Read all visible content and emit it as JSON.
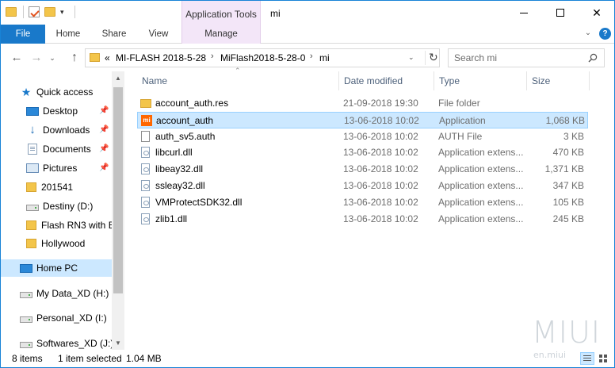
{
  "window": {
    "title": "mi",
    "contextual_group": "Application Tools",
    "controls": [
      "minimize",
      "maximize",
      "close"
    ]
  },
  "ribbon": {
    "tabs": [
      {
        "label": "File"
      },
      {
        "label": "Home"
      },
      {
        "label": "Share"
      },
      {
        "label": "View"
      },
      {
        "label": "Manage"
      }
    ],
    "help": "?"
  },
  "address": {
    "overflow": "«",
    "crumbs": [
      "MI-FLASH 2018-5-28",
      "MiFlash2018-5-28-0",
      "mi"
    ]
  },
  "search": {
    "placeholder": "Search mi"
  },
  "nav_pane": {
    "items": [
      {
        "label": "Quick access",
        "icon": "star-icon",
        "pinned": false
      },
      {
        "label": "Desktop",
        "icon": "desktop-icon",
        "pinned": true
      },
      {
        "label": "Downloads",
        "icon": "download-icon",
        "pinned": true
      },
      {
        "label": "Documents",
        "icon": "documents-icon",
        "pinned": true
      },
      {
        "label": "Pictures",
        "icon": "pictures-icon",
        "pinned": true
      },
      {
        "label": "201541",
        "icon": "folder-icon",
        "pinned": false
      },
      {
        "label": "Destiny (D:)",
        "icon": "drive-icon",
        "pinned": false
      },
      {
        "label": "Flash RN3 with E",
        "icon": "folder-icon",
        "pinned": false
      },
      {
        "label": "Hollywood",
        "icon": "folder-icon",
        "pinned": false
      },
      {
        "label": "Home PC",
        "icon": "pc-icon",
        "pinned": false
      },
      {
        "label": "My Data_XD (H:)",
        "icon": "drive-icon",
        "pinned": false
      },
      {
        "label": "Personal_XD (I:)",
        "icon": "drive-icon",
        "pinned": false
      },
      {
        "label": "Softwares_XD (J:)",
        "icon": "drive-icon",
        "pinned": false
      }
    ]
  },
  "file_list": {
    "columns": [
      "Name",
      "Date modified",
      "Type",
      "Size"
    ],
    "rows": [
      {
        "name": "account_auth.res",
        "date": "21-09-2018 19:30",
        "type": "File folder",
        "size": "",
        "icon": "folder-icon"
      },
      {
        "name": "account_auth",
        "date": "13-06-2018 10:02",
        "type": "Application",
        "size": "1,068 KB",
        "icon": "mi-app-icon",
        "selected": true
      },
      {
        "name": "auth_sv5.auth",
        "date": "13-06-2018 10:02",
        "type": "AUTH File",
        "size": "3 KB",
        "icon": "file-icon"
      },
      {
        "name": "libcurl.dll",
        "date": "13-06-2018 10:02",
        "type": "Application extens...",
        "size": "470 KB",
        "icon": "dll-icon"
      },
      {
        "name": "libeay32.dll",
        "date": "13-06-2018 10:02",
        "type": "Application extens...",
        "size": "1,371 KB",
        "icon": "dll-icon"
      },
      {
        "name": "ssleay32.dll",
        "date": "13-06-2018 10:02",
        "type": "Application extens...",
        "size": "347 KB",
        "icon": "dll-icon"
      },
      {
        "name": "VMProtectSDK32.dll",
        "date": "13-06-2018 10:02",
        "type": "Application extens...",
        "size": "105 KB",
        "icon": "dll-icon"
      },
      {
        "name": "zlib1.dll",
        "date": "13-06-2018 10:02",
        "type": "Application extens...",
        "size": "245 KB",
        "icon": "dll-icon"
      }
    ]
  },
  "status": {
    "item_count": "8 items",
    "selection": "1 item selected",
    "selection_size": "1.04 MB"
  },
  "watermark": {
    "logo": "MIUI",
    "site": "en.miui"
  },
  "colors": {
    "accent": "#1979ca",
    "selection": "#cce8ff",
    "contextual_tab": "#f3e6f8",
    "folder": "#f3c54a"
  }
}
